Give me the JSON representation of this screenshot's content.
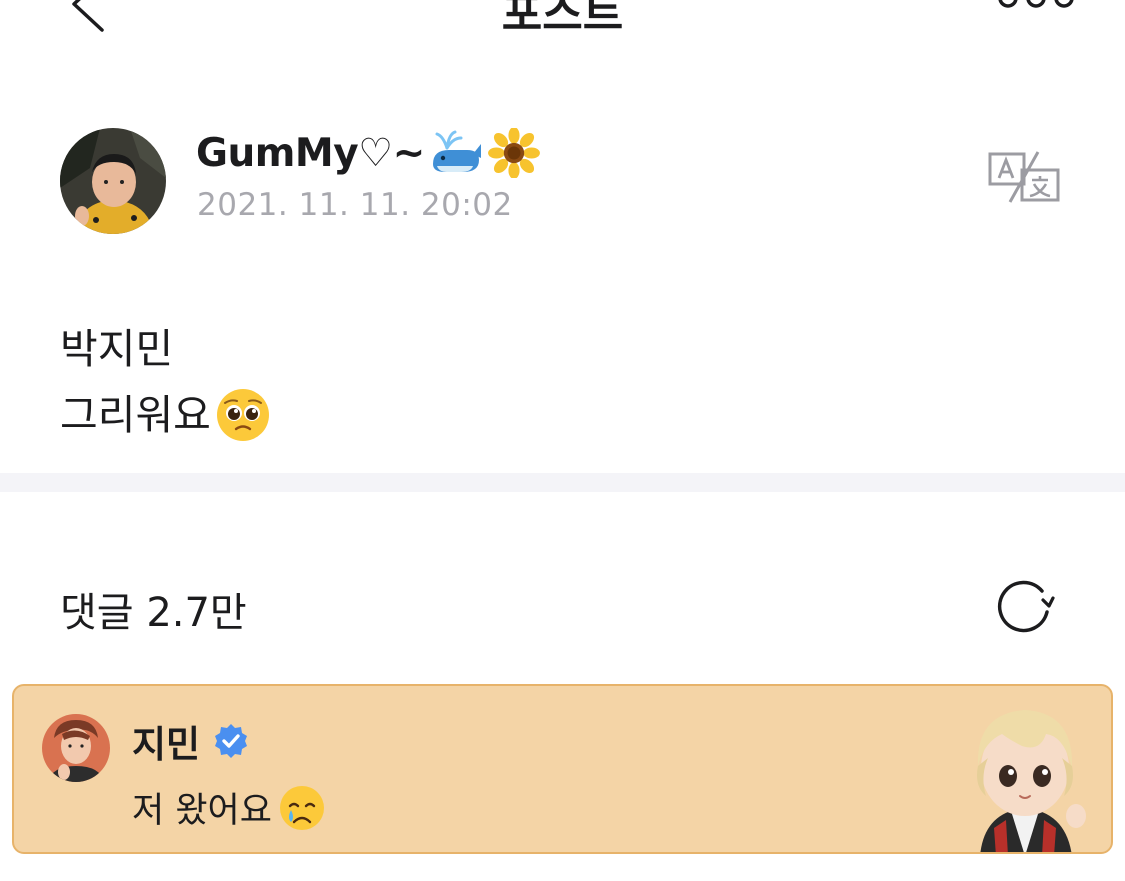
{
  "nav": {
    "title": "포스트",
    "back_icon": "chevron-left-icon",
    "more_icon": "more-dots-icon"
  },
  "post": {
    "author_name": "GumMy♡~",
    "author_emojis": [
      "whale-icon",
      "sunflower-icon"
    ],
    "timestamp": "2021. 11. 11. 20:02",
    "translate_icon": "translate-icon",
    "lines": [
      "박지민",
      "그리워요"
    ],
    "line_emoji": "pleading-face-icon"
  },
  "comments": {
    "title": "댓글 2.7만",
    "refresh_icon": "refresh-icon",
    "featured": {
      "author": "지민",
      "verified_icon": "verified-badge-icon",
      "text": "저 왔어요",
      "text_emoji": "crying-face-icon",
      "accent_color": "#f4d4a6",
      "border_color": "#e7b36a"
    }
  },
  "colors": {
    "text_primary": "#1c1c1e",
    "text_secondary": "#a8a8ae",
    "divider": "#f4f4f8",
    "verified": "#4a8ff0"
  }
}
